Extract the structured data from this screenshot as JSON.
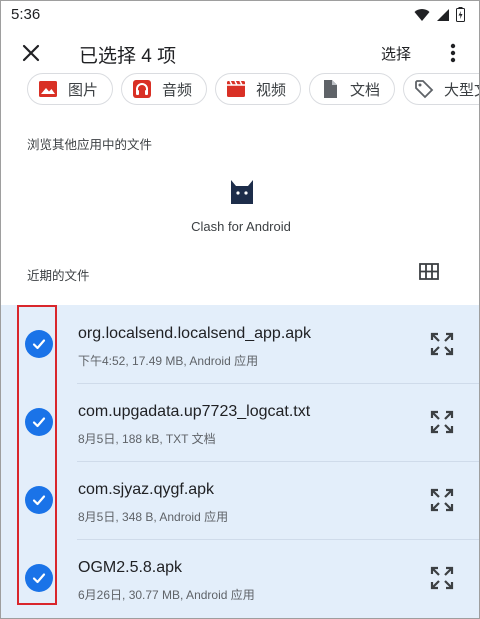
{
  "status_bar": {
    "time": "5:36"
  },
  "app_bar": {
    "title": "已选择 4 项",
    "select_label": "选择"
  },
  "chips": [
    {
      "label": "图片",
      "icon": "image-icon",
      "color": "#d93025"
    },
    {
      "label": "音频",
      "icon": "headphones-icon",
      "color": "#d93025"
    },
    {
      "label": "视频",
      "icon": "video-icon",
      "color": "#d93025"
    },
    {
      "label": "文档",
      "icon": "document-icon",
      "color": "#5f6368"
    },
    {
      "label": "大型文",
      "icon": "tag-icon",
      "color": "#5f6368"
    }
  ],
  "browse_section": {
    "label": "浏览其他应用中的文件",
    "app_name": "Clash for Android"
  },
  "recent_section": {
    "label": "近期的文件"
  },
  "files": [
    {
      "name": "org.localsend.localsend_app.apk",
      "meta": "下午4:52, 17.49 MB, Android 应用",
      "selected": true
    },
    {
      "name": "com.upgadata.up7723_logcat.txt",
      "meta": "8月5日, 188 kB, TXT 文档",
      "selected": true
    },
    {
      "name": "com.sjyaz.qygf.apk",
      "meta": "8月5日, 348 B, Android 应用",
      "selected": true
    },
    {
      "name": "OGM2.5.8.apk",
      "meta": "6月26日, 30.77 MB, Android 应用",
      "selected": true
    }
  ],
  "colors": {
    "accent": "#1a73e8",
    "selection_bg": "#e3eefa",
    "highlight": "#d9262c"
  }
}
